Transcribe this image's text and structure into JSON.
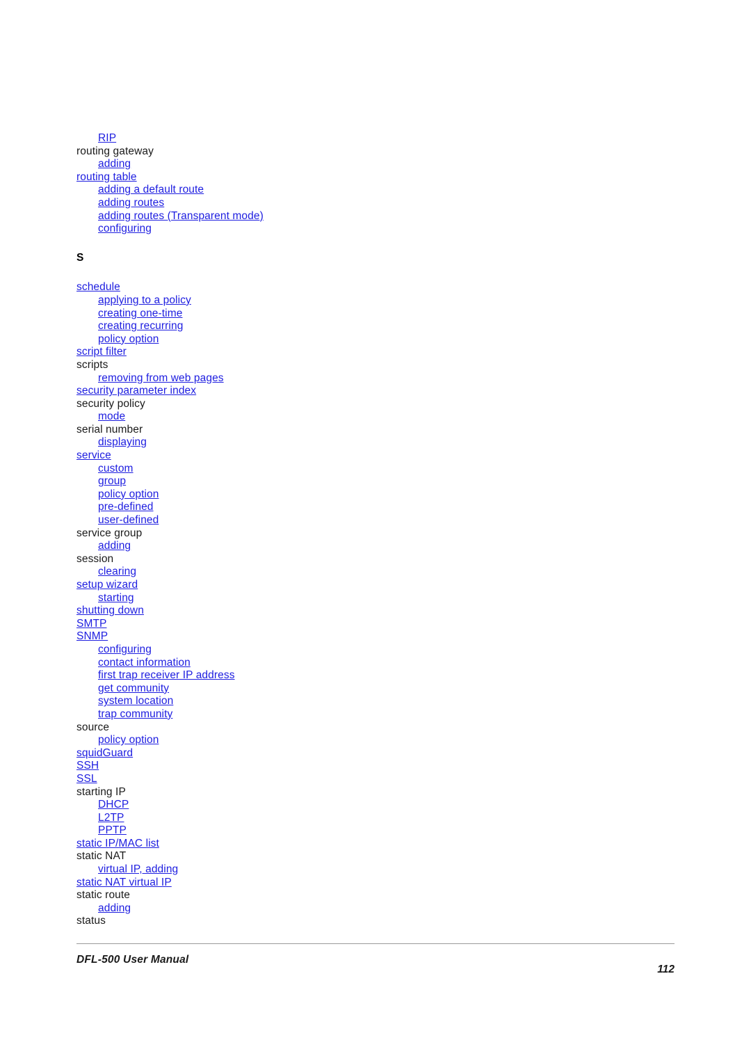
{
  "document": {
    "footer_title": "DFL-500 User Manual",
    "page_number": "112"
  },
  "colors": {
    "link": "#1d1de0",
    "text": "#1a1a1a",
    "rule": "#9a9a9a",
    "background": "#ffffff"
  },
  "index": {
    "continued_entries": [
      {
        "label": "RIP",
        "level": 1,
        "link": true
      },
      {
        "label": "routing gateway",
        "level": 0,
        "link": false
      },
      {
        "label": "adding",
        "level": 1,
        "link": true
      },
      {
        "label": "routing table",
        "level": 0,
        "link": true
      },
      {
        "label": "adding a default route",
        "level": 1,
        "link": true
      },
      {
        "label": "adding routes",
        "level": 1,
        "link": true
      },
      {
        "label": "adding routes (Transparent mode)",
        "level": 1,
        "link": true
      },
      {
        "label": "configuring",
        "level": 1,
        "link": true
      }
    ],
    "sections": [
      {
        "letter": "S",
        "entries": [
          {
            "label": "schedule",
            "level": 0,
            "link": true
          },
          {
            "label": "applying to a policy",
            "level": 1,
            "link": true
          },
          {
            "label": "creating one-time",
            "level": 1,
            "link": true
          },
          {
            "label": "creating recurring",
            "level": 1,
            "link": true
          },
          {
            "label": "policy option",
            "level": 1,
            "link": true
          },
          {
            "label": "script filter",
            "level": 0,
            "link": true
          },
          {
            "label": "scripts",
            "level": 0,
            "link": false
          },
          {
            "label": "removing from web pages",
            "level": 1,
            "link": true
          },
          {
            "label": "security parameter index",
            "level": 0,
            "link": true
          },
          {
            "label": "security policy",
            "level": 0,
            "link": false
          },
          {
            "label": "mode",
            "level": 1,
            "link": true
          },
          {
            "label": "serial number",
            "level": 0,
            "link": false
          },
          {
            "label": "displaying",
            "level": 1,
            "link": true
          },
          {
            "label": "service",
            "level": 0,
            "link": true
          },
          {
            "label": "custom",
            "level": 1,
            "link": true
          },
          {
            "label": "group",
            "level": 1,
            "link": true
          },
          {
            "label": "policy option",
            "level": 1,
            "link": true
          },
          {
            "label": "pre-defined",
            "level": 1,
            "link": true
          },
          {
            "label": "user-defined",
            "level": 1,
            "link": true
          },
          {
            "label": "service group",
            "level": 0,
            "link": false
          },
          {
            "label": "adding",
            "level": 1,
            "link": true
          },
          {
            "label": "session",
            "level": 0,
            "link": false
          },
          {
            "label": "clearing",
            "level": 1,
            "link": true
          },
          {
            "label": "setup wizard",
            "level": 0,
            "link": true
          },
          {
            "label": "starting",
            "level": 1,
            "link": true
          },
          {
            "label": "shutting down",
            "level": 0,
            "link": true
          },
          {
            "label": "SMTP",
            "level": 0,
            "link": true
          },
          {
            "label": "SNMP",
            "level": 0,
            "link": true
          },
          {
            "label": "configuring",
            "level": 1,
            "link": true
          },
          {
            "label": "contact information",
            "level": 1,
            "link": true
          },
          {
            "label": "first trap receiver IP address",
            "level": 1,
            "link": true
          },
          {
            "label": "get community",
            "level": 1,
            "link": true
          },
          {
            "label": "system location",
            "level": 1,
            "link": true
          },
          {
            "label": "trap community",
            "level": 1,
            "link": true
          },
          {
            "label": "source",
            "level": 0,
            "link": false
          },
          {
            "label": "policy option",
            "level": 1,
            "link": true
          },
          {
            "label": "squidGuard",
            "level": 0,
            "link": true
          },
          {
            "label": "SSH",
            "level": 0,
            "link": true
          },
          {
            "label": "SSL",
            "level": 0,
            "link": true
          },
          {
            "label": "starting IP",
            "level": 0,
            "link": false
          },
          {
            "label": "DHCP",
            "level": 1,
            "link": true
          },
          {
            "label": "L2TP",
            "level": 1,
            "link": true
          },
          {
            "label": "PPTP",
            "level": 1,
            "link": true
          },
          {
            "label": "static IP/MAC list",
            "level": 0,
            "link": true
          },
          {
            "label": "static NAT",
            "level": 0,
            "link": false
          },
          {
            "label": "virtual IP, adding",
            "level": 1,
            "link": true
          },
          {
            "label": "static NAT virtual IP",
            "level": 0,
            "link": true
          },
          {
            "label": "static route",
            "level": 0,
            "link": false
          },
          {
            "label": "adding",
            "level": 1,
            "link": true
          },
          {
            "label": "status",
            "level": 0,
            "link": false
          }
        ]
      }
    ]
  }
}
